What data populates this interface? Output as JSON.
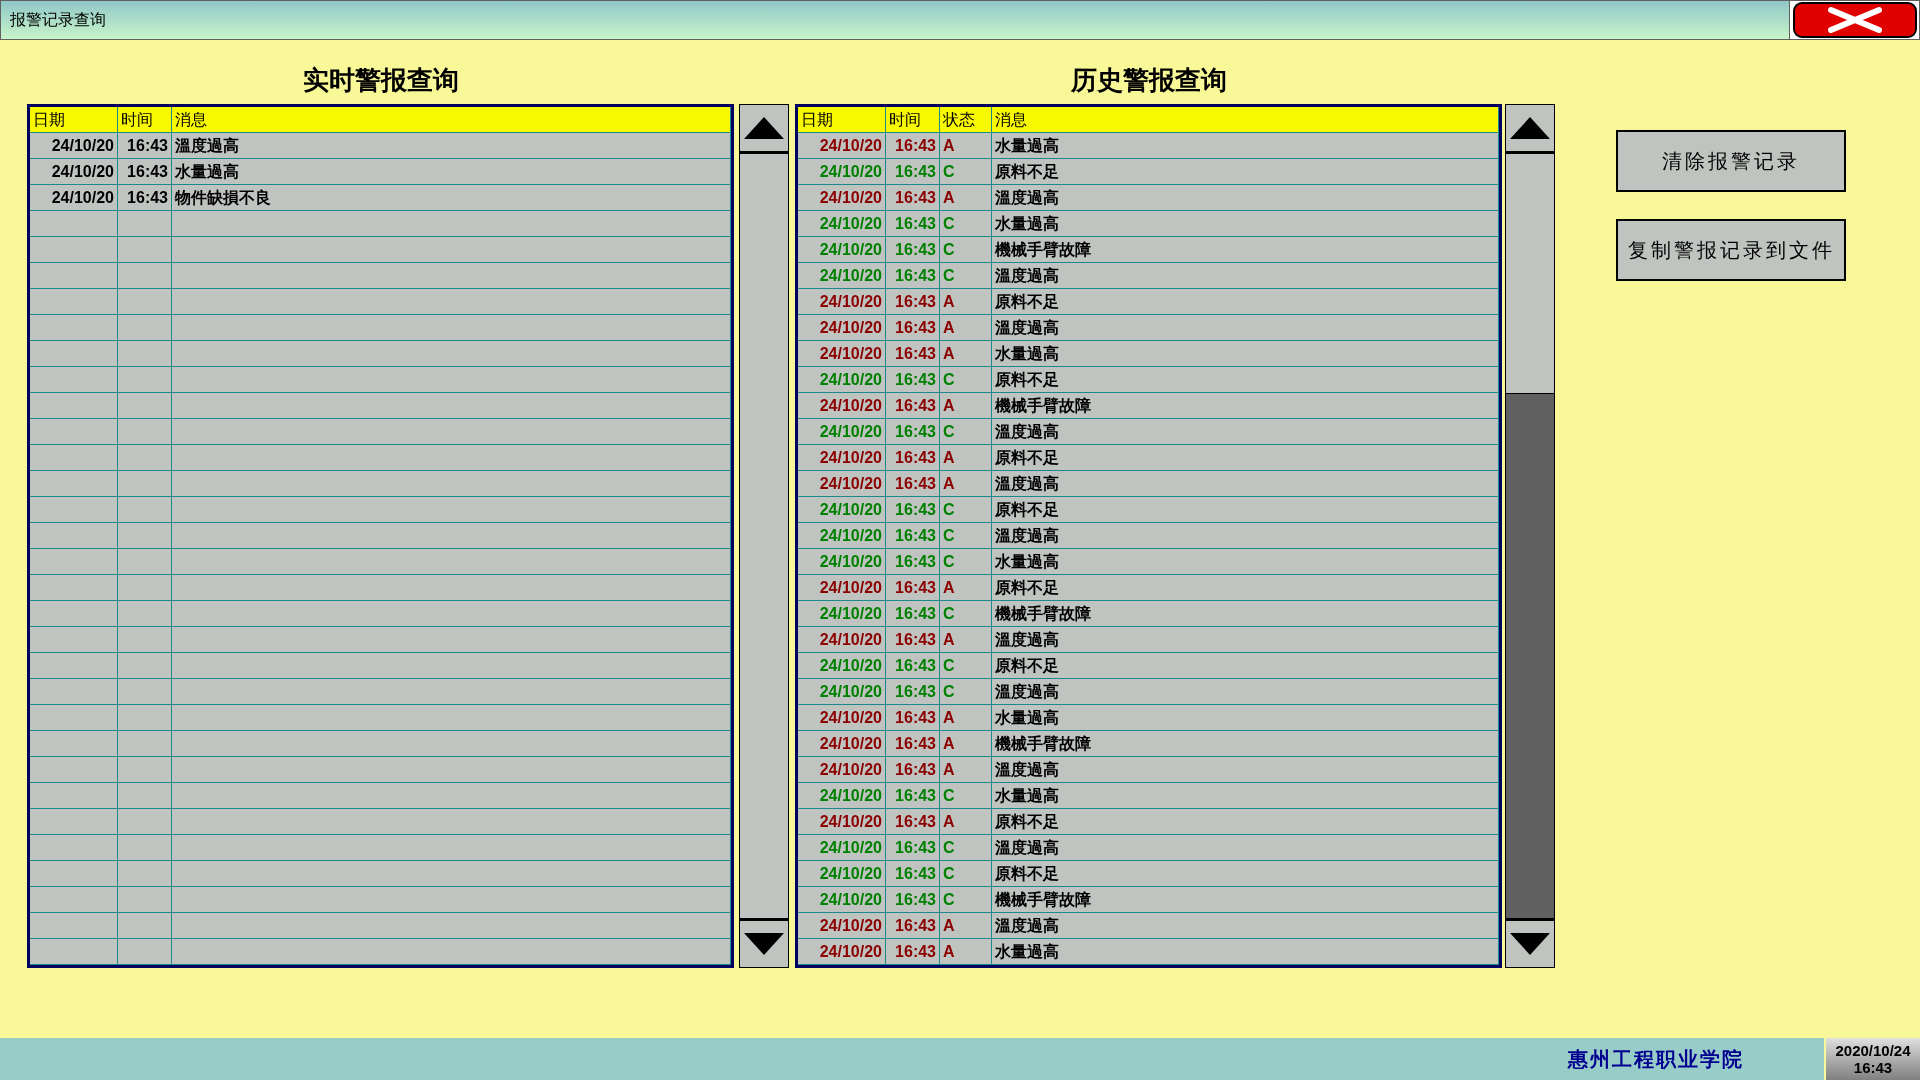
{
  "window": {
    "title": "报警记录查询"
  },
  "realtime": {
    "title": "实时警报查询",
    "columns": [
      "日期",
      "时间",
      "消息"
    ],
    "rows": [
      {
        "date": "24/10/20",
        "time": "16:43",
        "message": "溫度過高"
      },
      {
        "date": "24/10/20",
        "time": "16:43",
        "message": "水量過高"
      },
      {
        "date": "24/10/20",
        "time": "16:43",
        "message": "物件缺損不良"
      }
    ]
  },
  "history": {
    "title": "历史警报查询",
    "columns": [
      "日期",
      "时间",
      "状态",
      "消息"
    ],
    "rows": [
      {
        "date": "24/10/20",
        "time": "16:43",
        "status": "A",
        "message": "水量過高",
        "color": "#8b0000"
      },
      {
        "date": "24/10/20",
        "time": "16:43",
        "status": "C",
        "message": "原料不足",
        "color": "#008000"
      },
      {
        "date": "24/10/20",
        "time": "16:43",
        "status": "A",
        "message": "溫度過高",
        "color": "#8b0000"
      },
      {
        "date": "24/10/20",
        "time": "16:43",
        "status": "C",
        "message": "水量過高",
        "color": "#008000"
      },
      {
        "date": "24/10/20",
        "time": "16:43",
        "status": "C",
        "message": "機械手臂故障",
        "color": "#008000"
      },
      {
        "date": "24/10/20",
        "time": "16:43",
        "status": "C",
        "message": "溫度過高",
        "color": "#008000"
      },
      {
        "date": "24/10/20",
        "time": "16:43",
        "status": "A",
        "message": "原料不足",
        "color": "#8b0000"
      },
      {
        "date": "24/10/20",
        "time": "16:43",
        "status": "A",
        "message": "溫度過高",
        "color": "#8b0000"
      },
      {
        "date": "24/10/20",
        "time": "16:43",
        "status": "A",
        "message": "水量過高",
        "color": "#8b0000"
      },
      {
        "date": "24/10/20",
        "time": "16:43",
        "status": "C",
        "message": "原料不足",
        "color": "#008000"
      },
      {
        "date": "24/10/20",
        "time": "16:43",
        "status": "A",
        "message": "機械手臂故障",
        "color": "#8b0000"
      },
      {
        "date": "24/10/20",
        "time": "16:43",
        "status": "C",
        "message": "溫度過高",
        "color": "#008000"
      },
      {
        "date": "24/10/20",
        "time": "16:43",
        "status": "A",
        "message": "原料不足",
        "color": "#8b0000"
      },
      {
        "date": "24/10/20",
        "time": "16:43",
        "status": "A",
        "message": "溫度過高",
        "color": "#8b0000"
      },
      {
        "date": "24/10/20",
        "time": "16:43",
        "status": "C",
        "message": "原料不足",
        "color": "#008000"
      },
      {
        "date": "24/10/20",
        "time": "16:43",
        "status": "C",
        "message": "溫度過高",
        "color": "#008000"
      },
      {
        "date": "24/10/20",
        "time": "16:43",
        "status": "C",
        "message": "水量過高",
        "color": "#008000"
      },
      {
        "date": "24/10/20",
        "time": "16:43",
        "status": "A",
        "message": "原料不足",
        "color": "#8b0000"
      },
      {
        "date": "24/10/20",
        "time": "16:43",
        "status": "C",
        "message": "機械手臂故障",
        "color": "#008000"
      },
      {
        "date": "24/10/20",
        "time": "16:43",
        "status": "A",
        "message": "溫度過高",
        "color": "#8b0000"
      },
      {
        "date": "24/10/20",
        "time": "16:43",
        "status": "C",
        "message": "原料不足",
        "color": "#008000"
      },
      {
        "date": "24/10/20",
        "time": "16:43",
        "status": "C",
        "message": "溫度過高",
        "color": "#008000"
      },
      {
        "date": "24/10/20",
        "time": "16:43",
        "status": "A",
        "message": "水量過高",
        "color": "#8b0000"
      },
      {
        "date": "24/10/20",
        "time": "16:43",
        "status": "A",
        "message": "機械手臂故障",
        "color": "#8b0000"
      },
      {
        "date": "24/10/20",
        "time": "16:43",
        "status": "A",
        "message": "溫度過高",
        "color": "#8b0000"
      },
      {
        "date": "24/10/20",
        "time": "16:43",
        "status": "C",
        "message": "水量過高",
        "color": "#008000"
      },
      {
        "date": "24/10/20",
        "time": "16:43",
        "status": "A",
        "message": "原料不足",
        "color": "#8b0000"
      },
      {
        "date": "24/10/20",
        "time": "16:43",
        "status": "C",
        "message": "溫度過高",
        "color": "#008000"
      },
      {
        "date": "24/10/20",
        "time": "16:43",
        "status": "C",
        "message": "原料不足",
        "color": "#008000"
      },
      {
        "date": "24/10/20",
        "time": "16:43",
        "status": "C",
        "message": "機械手臂故障",
        "color": "#008000"
      },
      {
        "date": "24/10/20",
        "time": "16:43",
        "status": "A",
        "message": "溫度過高",
        "color": "#8b0000"
      },
      {
        "date": "24/10/20",
        "time": "16:43",
        "status": "A",
        "message": "水量過高",
        "color": "#8b0000"
      }
    ]
  },
  "buttons": [
    "清除报警记录",
    "复制警报记录到文件"
  ],
  "footer": {
    "institution": "惠州工程职业学院",
    "clock_date": "2020/10/24",
    "clock_time": "16:43"
  }
}
